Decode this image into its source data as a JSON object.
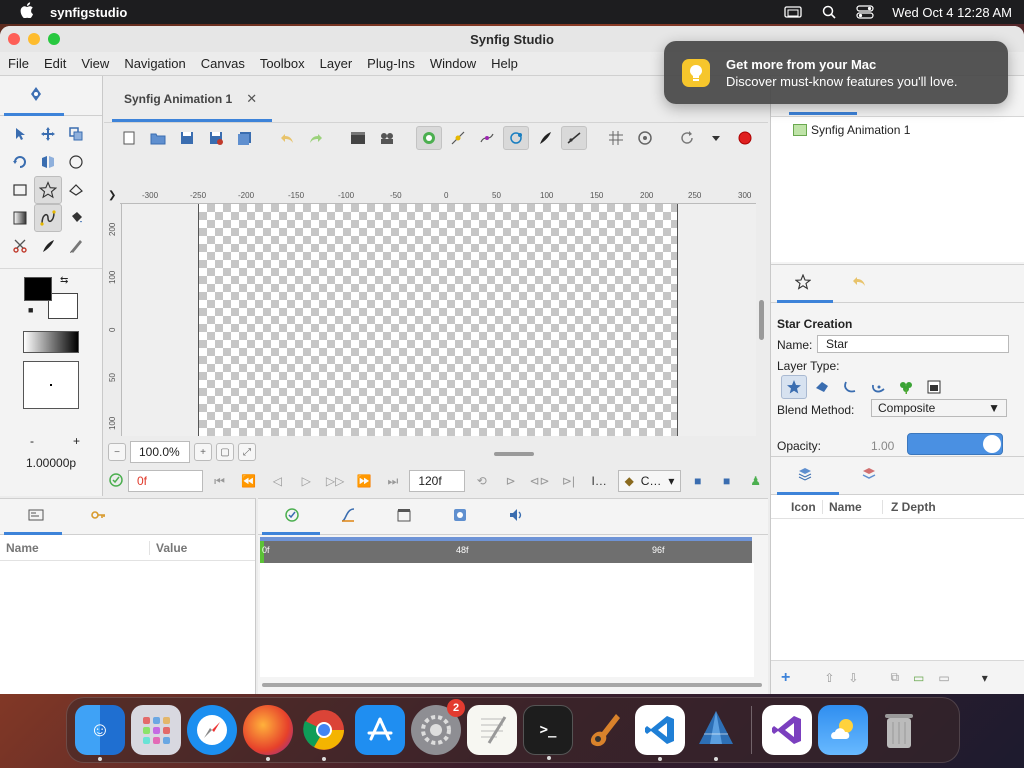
{
  "macos": {
    "app_name": "synfigstudio",
    "datetime": "Wed Oct 4  12:28 AM"
  },
  "window": {
    "title": "Synfig Studio"
  },
  "menu": {
    "items": [
      "File",
      "Edit",
      "View",
      "Navigation",
      "Canvas",
      "Toolbox",
      "Layer",
      "Plug-Ins",
      "Window",
      "Help"
    ]
  },
  "toolbox": {
    "brush_size": "1.00000p",
    "size_minus": "-",
    "size_plus": "+"
  },
  "document": {
    "tab_label": "Synfig Animation 1",
    "close_glyph": "✕"
  },
  "ruler": {
    "h_labels": [
      "-300",
      "-250",
      "-200",
      "-150",
      "-100",
      "-50",
      "0",
      "50",
      "100",
      "150",
      "200",
      "250",
      "300"
    ],
    "v_labels": [
      "0",
      "50",
      "100",
      "150",
      "200"
    ]
  },
  "canvas_controls": {
    "zoom": "100.0%",
    "current_time": "0f",
    "end_time": "120f",
    "interp_label": "C…",
    "info_label": "I…"
  },
  "canvas_browser": {
    "item": "Synfig Animation 1"
  },
  "tool_options": {
    "title": "Star Creation",
    "name_label": "Name:",
    "name_value": "Star",
    "layer_type_label": "Layer Type:",
    "blend_label": "Blend Method:",
    "blend_value": "Composite",
    "opacity_label": "Opacity:",
    "opacity_value": "1.00"
  },
  "layers": {
    "col_icon": "Icon",
    "col_name": "Name",
    "col_z": "Z Depth"
  },
  "params": {
    "col_name": "Name",
    "col_value": "Value"
  },
  "timetrack": {
    "labels": [
      "0f",
      "48f",
      "96f"
    ]
  },
  "notification": {
    "title": "Get more from your Mac",
    "body": "Discover must-know features you'll love."
  },
  "dock": {
    "settings_badge": "2"
  },
  "colors": {
    "accent": "#3d83d9",
    "fill_color": "#000000",
    "outline_color": "#ffffff",
    "time_text": "#e0392a"
  }
}
